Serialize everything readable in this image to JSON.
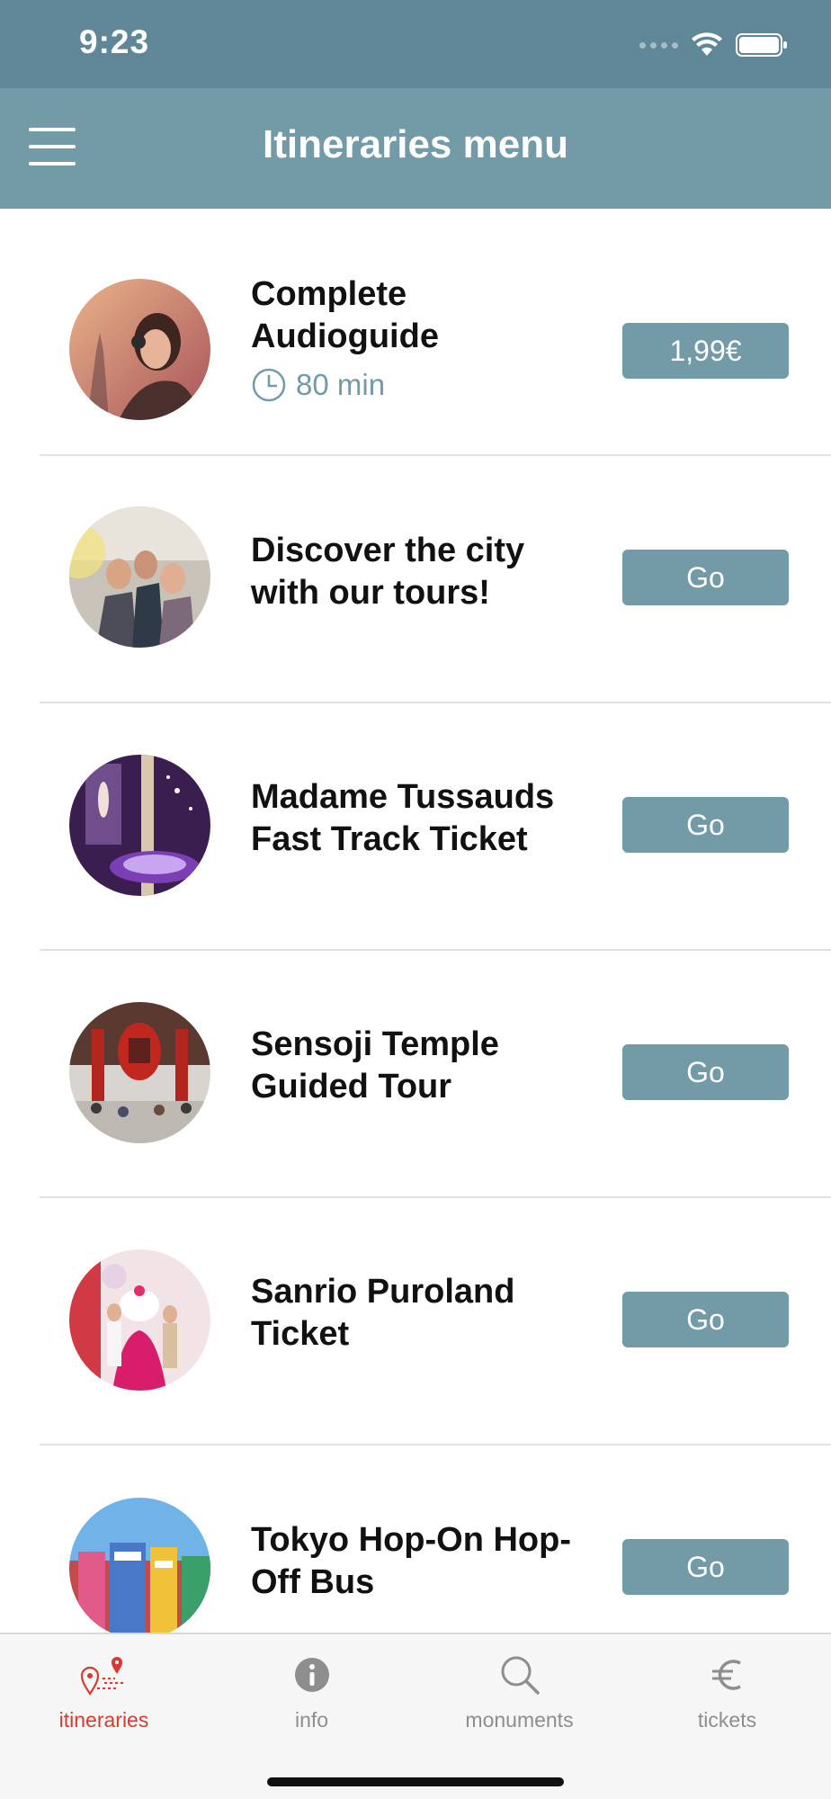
{
  "status_bar": {
    "time": "9:23"
  },
  "header": {
    "title": "Itineraries menu"
  },
  "items": [
    {
      "title_line1": "Complete",
      "title_line2": "Audioguide",
      "duration": "80 min",
      "button": "1,99€"
    },
    {
      "title_line1": "Discover the city",
      "title_line2": "with our tours!",
      "button": "Go"
    },
    {
      "title_line1": "Madame Tussauds",
      "title_line2": "Fast Track Ticket",
      "button": "Go"
    },
    {
      "title_line1": "Sensoji Temple",
      "title_line2": "Guided Tour",
      "button": "Go"
    },
    {
      "title_line1": "Sanrio Puroland",
      "title_line2": "Ticket",
      "button": "Go"
    },
    {
      "title_line1": "Tokyo Hop-On Hop-",
      "title_line2": "Off Bus",
      "button": "Go"
    }
  ],
  "tabs": [
    {
      "label": "itineraries",
      "icon": "map-route-icon",
      "active": true
    },
    {
      "label": "info",
      "icon": "info-icon",
      "active": false
    },
    {
      "label": "monuments",
      "icon": "search-icon",
      "active": false
    },
    {
      "label": "tickets",
      "icon": "euro-icon",
      "active": false
    }
  ],
  "colors": {
    "status_bar": "#5f8798",
    "nav_bar": "#729ba7",
    "button": "#729ba7",
    "active_tab": "#d93a30",
    "inactive_tab": "#8e8e8e"
  }
}
